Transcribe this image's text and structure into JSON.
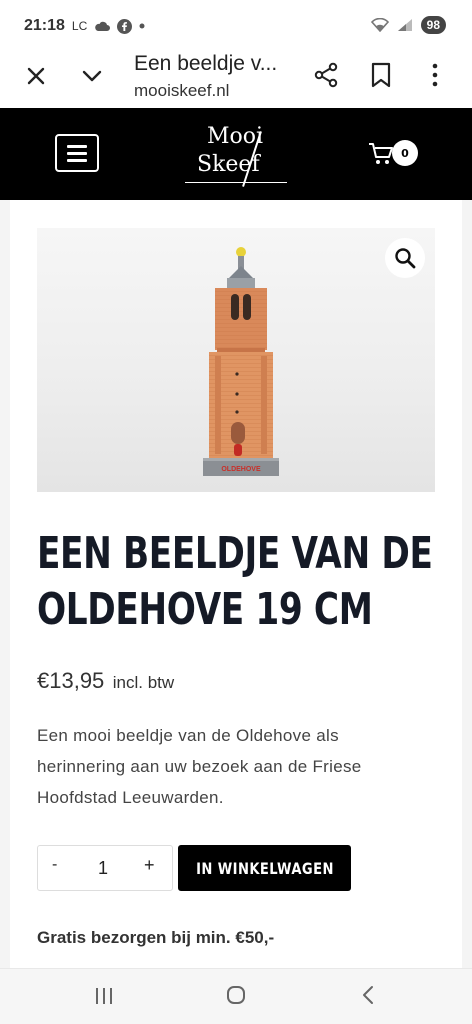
{
  "status_bar": {
    "time": "21:18",
    "carrier": "LC",
    "battery": "98"
  },
  "browser": {
    "page_title": "Een beeldje v...",
    "url": "mooiskeef.nl"
  },
  "site_header": {
    "logo_line1": "Mooi",
    "logo_line2": "Skeef",
    "cart_count": "0"
  },
  "product": {
    "title_line1": "EEN BEELDJE VAN DE",
    "title_line2": "OLDEHOVE 19 CM",
    "price": "€13,95",
    "price_note": "incl. btw",
    "description_line1": "Een mooi beeldje van de Oldehove als",
    "description_line2": "herinnering aan uw bezoek aan de Friese",
    "description_line3": "Hoofdstad Leeuwarden.",
    "quantity_minus": "-",
    "quantity": "1",
    "quantity_plus": "+",
    "add_to_cart": "IN WINKELWAGEN",
    "shipping_note": "Gratis bezorgen bij min. €50,-",
    "figurine_base_text": "OLDEHOVE"
  },
  "colors": {
    "header_bg": "#000000",
    "title_color": "#151a26",
    "button_bg": "#000000"
  },
  "icons": {
    "close": "close-icon",
    "chevron": "chevron-down-icon",
    "share": "share-icon",
    "bookmark": "bookmark-icon",
    "more": "more-vert-icon",
    "menu": "hamburger-menu-icon",
    "cart": "cart-icon",
    "zoom": "search-icon"
  }
}
